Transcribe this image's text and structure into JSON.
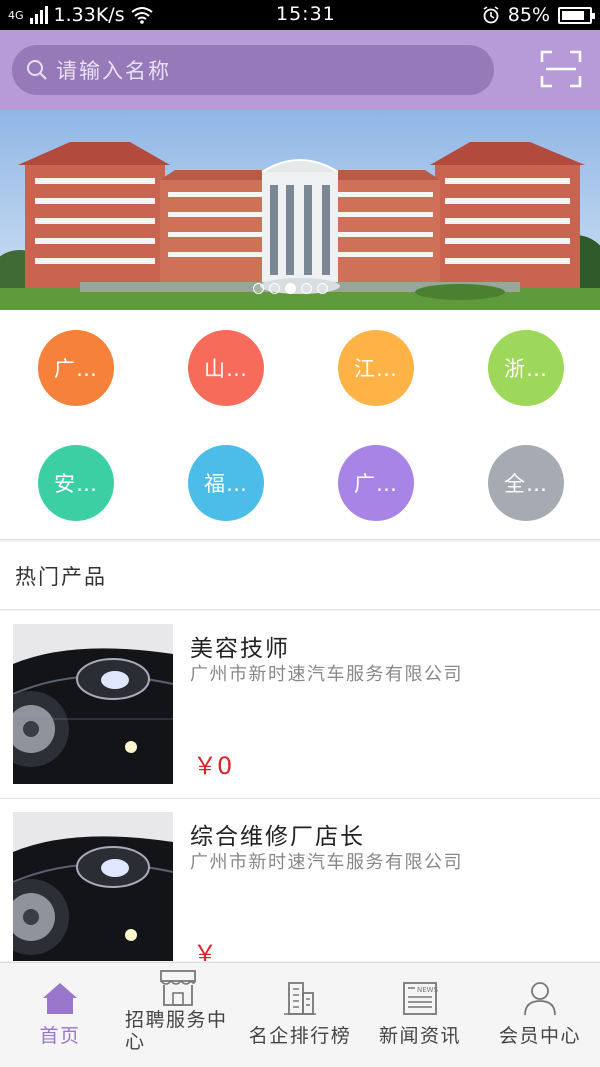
{
  "status_bar": {
    "network": "4G",
    "speed": "1.33K/s",
    "time": "15:31",
    "battery": "85%",
    "battery_level": 0.85
  },
  "search": {
    "placeholder": "请输入名称"
  },
  "banner": {
    "slide_count": 5,
    "active_index": 2
  },
  "categories": [
    {
      "label": "广…",
      "color": "#f5813a"
    },
    {
      "label": "山…",
      "color": "#f76b5a"
    },
    {
      "label": "江…",
      "color": "#ffb347"
    },
    {
      "label": "浙…",
      "color": "#9ed85a"
    },
    {
      "label": "安…",
      "color": "#3dcfa4"
    },
    {
      "label": "福…",
      "color": "#4bbde8"
    },
    {
      "label": "广…",
      "color": "#a884e6"
    },
    {
      "label": "全…",
      "color": "#a6abb3"
    }
  ],
  "section": {
    "title": "热门产品"
  },
  "products": [
    {
      "title": "美容技师",
      "company": "广州市新时速汽车服务有限公司",
      "price": "￥0"
    },
    {
      "title": "综合维修厂店长",
      "company": "广州市新时速汽车服务有限公司",
      "price": "￥"
    }
  ],
  "tabs": [
    {
      "label": "首页",
      "icon": "home-icon",
      "active": true
    },
    {
      "label": "招聘服务中心",
      "icon": "storefront-icon",
      "active": false
    },
    {
      "label": "名企排行榜",
      "icon": "building-icon",
      "active": false
    },
    {
      "label": "新闻资讯",
      "icon": "newspaper-icon",
      "active": false
    },
    {
      "label": "会员中心",
      "icon": "user-icon",
      "active": false
    }
  ],
  "colors": {
    "accent": "#b79ad8",
    "price": "#d8262d",
    "tab_active": "#9a76cc"
  }
}
